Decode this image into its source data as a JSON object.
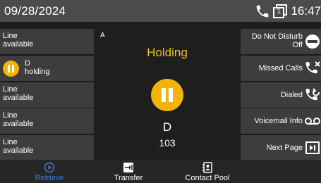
{
  "status_bar": {
    "date": "09/28/2024",
    "time": "16:47",
    "icons": [
      "phone-icon",
      "message-count-icon"
    ],
    "message_count": "1"
  },
  "line_keys": [
    {
      "label": "Line\navailable",
      "state": "available"
    },
    {
      "label": "D\nholding",
      "state": "holding",
      "icon": "hold-icon"
    },
    {
      "label": "Line\navailable",
      "state": "available"
    },
    {
      "label": "Line\navailable",
      "state": "available"
    },
    {
      "label": "Line\navailable",
      "state": "available"
    }
  ],
  "call": {
    "line_id": "A",
    "state": "Holding",
    "name": "D",
    "number": "103",
    "icon": "hold-icon"
  },
  "function_keys": [
    {
      "label": "Do Not Disturb\nOff",
      "icon": "do-not-disturb-icon"
    },
    {
      "label": "Missed Calls",
      "icon": "missed-calls-icon"
    },
    {
      "label": "Dialed",
      "icon": "dialed-calls-icon"
    },
    {
      "label": "Voicemail Info",
      "icon": "voicemail-icon"
    },
    {
      "label": "Next Page",
      "icon": "next-page-icon"
    }
  ],
  "softkeys": [
    {
      "label": "Retrieve",
      "icon": "retrieve-icon",
      "active": true
    },
    {
      "label": "Transfer",
      "icon": "transfer-icon"
    },
    {
      "label": "Contact Pool",
      "icon": "contact-pool-icon"
    }
  ],
  "colors": {
    "status_bar": "#4b4b4b",
    "key_background": "#3d3d3d",
    "hold_accent": "#f2b409",
    "holding_text": "#f2c21c",
    "active_softkey": "#3a7fd6"
  }
}
